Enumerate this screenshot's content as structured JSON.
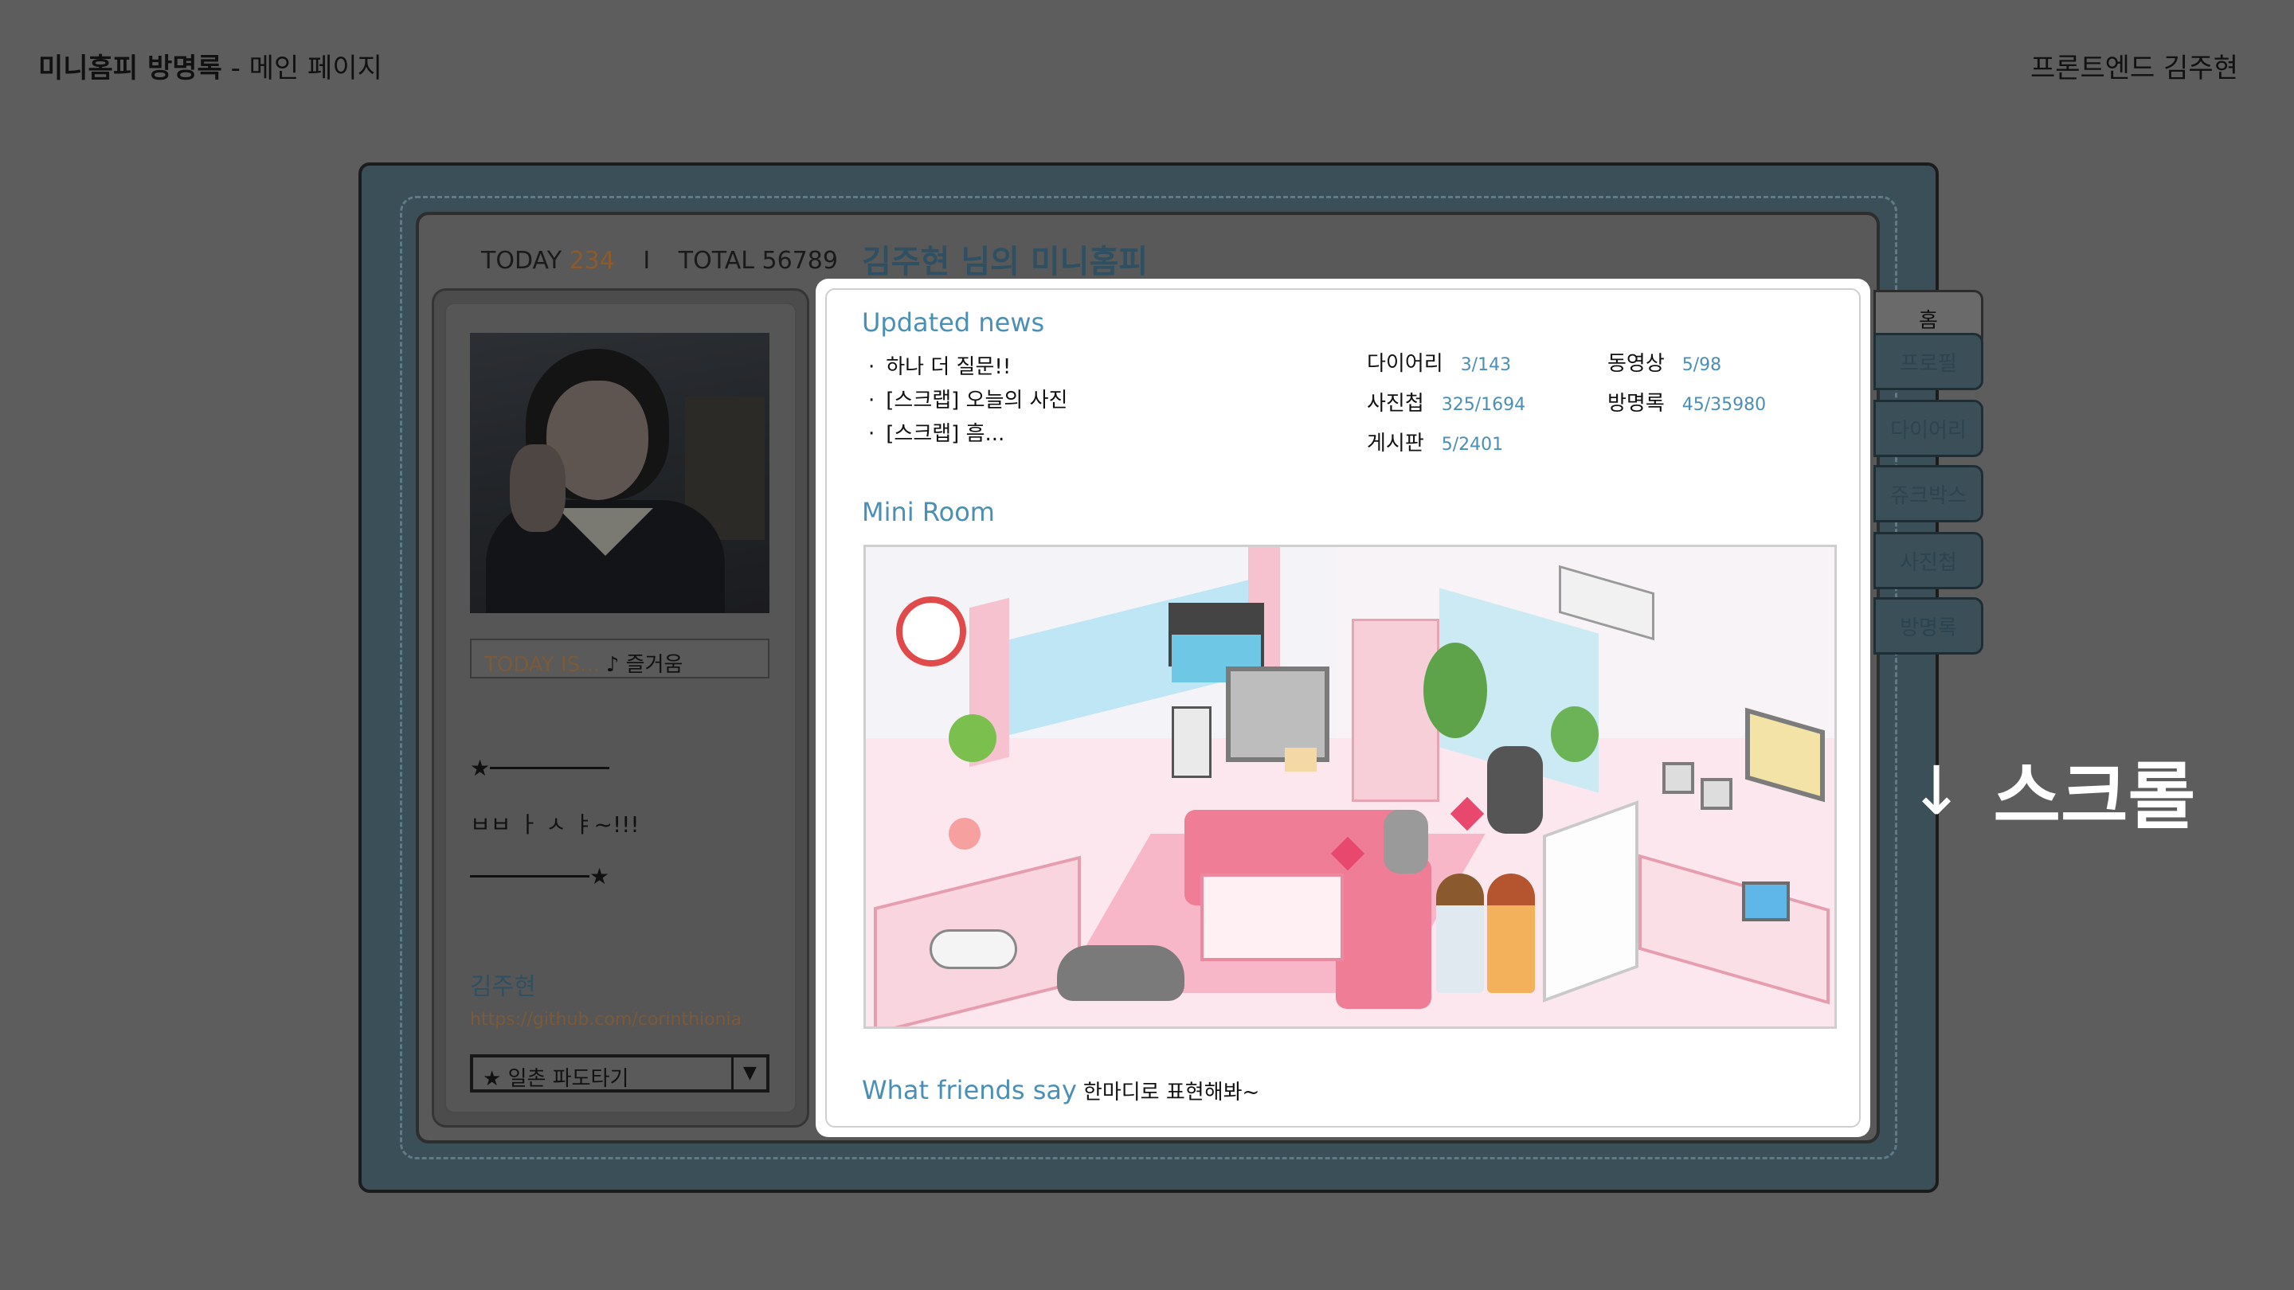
{
  "slide": {
    "title_bold": "미니홈피 방명록",
    "title_rest": " - 메인 페이지",
    "author": "프론트엔드 김주현"
  },
  "counter": {
    "today_label": "TODAY",
    "today_value": "234",
    "separator": "I",
    "total_label": "TOTAL",
    "total_value": "56789"
  },
  "home_title": "김주현 님의 미니홈피",
  "profile": {
    "today_is_label": "TODAY IS...",
    "today_is_value": "♪ 즐거움",
    "star": "★",
    "message": "ㅂㅂ ㅏ ㅅ ㅑ~!!!",
    "name": "김주현",
    "url": "https://github.com/corinthionia",
    "wave_select": "★ 일촌 파도타기",
    "wave_arrow": "▼"
  },
  "tabs": [
    "홈",
    "프로필",
    "다이어리",
    "쥬크박스",
    "사진첩",
    "방명록"
  ],
  "updated_news": {
    "title": "Updated news",
    "items": [
      "하나 더 질문!!",
      "[스크랩] 오늘의 사진",
      "[스크랩] 흠..."
    ]
  },
  "stats": {
    "diary_label": "다이어리",
    "diary_value": "3/143",
    "video_label": "동영상",
    "video_value": "5/98",
    "photo_label": "사진첩",
    "photo_value": "325/1694",
    "guestbook_label": "방명록",
    "guestbook_value": "45/35980",
    "board_label": "게시판",
    "board_value": "5/2401"
  },
  "mini_room": {
    "title": "Mini Room"
  },
  "friends": {
    "title": "What friends say",
    "text": "한마디로 표현해봐~"
  },
  "scroll_hint": {
    "arrow": "↓",
    "label": "스크롤"
  },
  "colors": {
    "background_dim": "#5d5d5d",
    "accent_blue": "#4a8fb5",
    "frame_teal": "#3a4f57",
    "counter_orange": "#8c5a2b"
  }
}
